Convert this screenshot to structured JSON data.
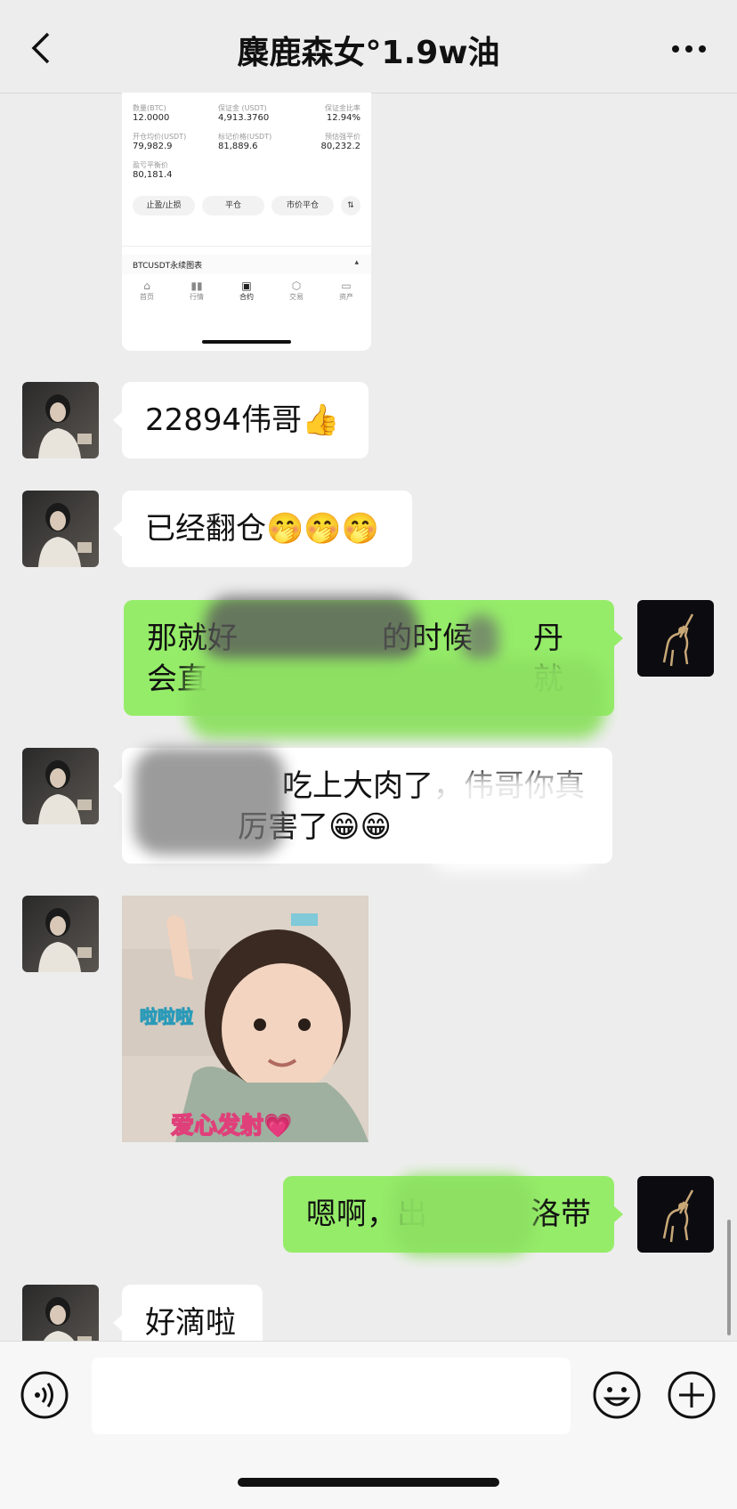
{
  "header": {
    "title": "麋鹿森女°1.9w油",
    "back_icon": "chevron-left-icon",
    "more_icon": "ellipsis-icon"
  },
  "trade_screenshot": {
    "fields": [
      {
        "label": "数量(BTC)",
        "value": "12.0000"
      },
      {
        "label": "保证金 (USDT)",
        "value": "4,913.3760"
      },
      {
        "label": "保证金比率",
        "value": "12.94%"
      },
      {
        "label": "开仓均价(USDT)",
        "value": "79,982.9"
      },
      {
        "label": "标记价格(USDT)",
        "value": "81,889.6"
      },
      {
        "label": "预估强平价",
        "value": "80,232.2"
      },
      {
        "label": "盈亏平衡价",
        "value": "80,181.4"
      }
    ],
    "buttons": [
      "止盈/止损",
      "平仓",
      "市价平仓"
    ],
    "chart_label": "BTCUSDT永续图表",
    "nav": [
      "首页",
      "行情",
      "合约",
      "交易",
      "资产"
    ]
  },
  "messages": [
    {
      "side": "left",
      "text": "22894伟哥👍"
    },
    {
      "side": "left",
      "text": "已经翻仓🤭🤭🤭"
    },
    {
      "side": "right",
      "text_line1": "那就好",
      "text_mid": "的时候",
      "text_end": "丹就",
      "text_line2": "会直"
    },
    {
      "side": "left",
      "text_line1": "吃上大肉了，伟哥你真",
      "text_line2": "厉害了😁😁"
    },
    {
      "side": "left",
      "type": "sticker",
      "caption_top": "啦啦啦",
      "caption_bottom": "爱心发射💗"
    },
    {
      "side": "right",
      "text_start": "嗯啊，出",
      "text_end": "洛带"
    },
    {
      "side": "left",
      "text": "好滴啦"
    }
  ],
  "bottom": {
    "voice_icon": "voice-icon",
    "emoji_icon": "emoji-icon",
    "plus_icon": "plus-icon"
  },
  "colors": {
    "background": "#ededed",
    "right_bubble": "#95ec69",
    "left_bubble": "#ffffff"
  }
}
